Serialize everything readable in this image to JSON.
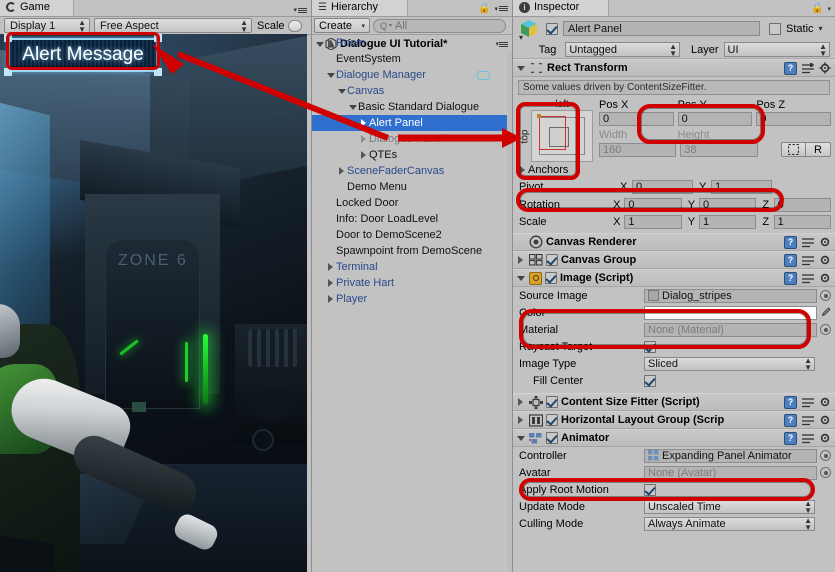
{
  "game": {
    "tab_label": "Game",
    "display_dropdown": "Display 1",
    "aspect_dropdown": "Free Aspect",
    "scale_label": "Scale",
    "alert_panel_text": "Alert Message",
    "scene_sign_text": "ZONE 6"
  },
  "hierarchy": {
    "tab_label": "Hierarchy",
    "create_button": "Create",
    "search_placeholder": "All",
    "scene_name": "Dialogue UI Tutorial*",
    "items": [
      {
        "label": "Room",
        "depth": 1,
        "arrow": "right",
        "style": "prefab"
      },
      {
        "label": "EventSystem",
        "depth": 1,
        "arrow": "none",
        "style": "normal"
      },
      {
        "label": "Dialogue Manager",
        "depth": 1,
        "arrow": "down",
        "style": "prefab",
        "badge": "comment-icon"
      },
      {
        "label": "Canvas",
        "depth": 2,
        "arrow": "down",
        "style": "prefab"
      },
      {
        "label": "Basic Standard Dialogue",
        "depth": 3,
        "arrow": "down",
        "style": "normal"
      },
      {
        "label": "Alert Panel",
        "depth": 4,
        "arrow": "right",
        "style": "normal",
        "selected": true
      },
      {
        "label": "Dialogue Panel",
        "depth": 4,
        "arrow": "right",
        "style": "dim"
      },
      {
        "label": "QTEs",
        "depth": 4,
        "arrow": "right",
        "style": "normal"
      },
      {
        "label": "SceneFaderCanvas",
        "depth": 2,
        "arrow": "right",
        "style": "prefab"
      },
      {
        "label": "Demo Menu",
        "depth": 2,
        "arrow": "none",
        "style": "normal"
      },
      {
        "label": "Locked Door",
        "depth": 1,
        "arrow": "none",
        "style": "normal"
      },
      {
        "label": "Info: Door LoadLevel",
        "depth": 1,
        "arrow": "none",
        "style": "normal"
      },
      {
        "label": "Door to DemoScene2",
        "depth": 1,
        "arrow": "none",
        "style": "normal"
      },
      {
        "label": "Spawnpoint from DemoScene",
        "depth": 1,
        "arrow": "none",
        "style": "normal"
      },
      {
        "label": "Terminal",
        "depth": 1,
        "arrow": "right",
        "style": "prefab"
      },
      {
        "label": "Private Hart",
        "depth": 1,
        "arrow": "right",
        "style": "prefab"
      },
      {
        "label": "Player",
        "depth": 1,
        "arrow": "right",
        "style": "prefab"
      }
    ]
  },
  "inspector": {
    "tab_label": "Inspector",
    "object_name": "Alert Panel",
    "object_enabled": true,
    "static_label": "Static",
    "static_checked": false,
    "tag_label": "Tag",
    "tag_value": "Untagged",
    "layer_label": "Layer",
    "layer_value": "UI",
    "rect_transform": {
      "title": "Rect Transform",
      "driven_note": "Some values driven by ContentSizeFitter.",
      "anchor_preset_label": "left",
      "anchor_preset_vlabel": "top",
      "pos_x_label": "Pos X",
      "pos_x_value": "0",
      "pos_y_label": "Pos Y",
      "pos_y_value": "0",
      "pos_z_label": "Pos Z",
      "pos_z_value": "0",
      "width_label": "Width",
      "width_value": "160",
      "height_label": "Height",
      "height_value": "38",
      "blueprint_button": "blueprint-icon",
      "raw_button": "R",
      "anchors_label": "Anchors",
      "pivot_label": "Pivot",
      "pivot_x_axis": "X",
      "pivot_x_value": "0",
      "pivot_y_axis": "Y",
      "pivot_y_value": "1",
      "rotation_label": "Rotation",
      "rotation_x": "0",
      "rotation_y": "0",
      "rotation_z": "0",
      "scale_label": "Scale",
      "scale_x": "1",
      "scale_y": "1",
      "scale_z": "1",
      "axis_x": "X",
      "axis_y": "Y",
      "axis_z": "Z"
    },
    "canvas_renderer": {
      "title": "Canvas Renderer"
    },
    "canvas_group": {
      "title": "Canvas Group",
      "enabled": true
    },
    "image_script": {
      "title": "Image (Script)",
      "enabled": true,
      "source_image_label": "Source Image",
      "source_image_value": "Dialog_stripes",
      "color_label": "Color",
      "color_value": "#FFFFFF",
      "material_label": "Material",
      "material_value": "None (Material)",
      "raycast_label": "Raycast Target",
      "raycast_checked": true,
      "image_type_label": "Image Type",
      "image_type_value": "Sliced",
      "fill_center_label": "Fill Center",
      "fill_center_checked": true
    },
    "content_size_fitter": {
      "title": "Content Size Fitter (Script)",
      "enabled": true
    },
    "horizontal_layout_group": {
      "title": "Horizontal Layout Group (Scrip",
      "enabled": true
    },
    "animator": {
      "title": "Animator",
      "enabled": true,
      "controller_label": "Controller",
      "controller_value": "Expanding Panel Animator",
      "avatar_label": "Avatar",
      "avatar_value": "None (Avatar)",
      "apply_root_motion_label": "Apply Root Motion",
      "apply_root_motion_checked": true,
      "update_mode_label": "Update Mode",
      "update_mode_value": "Unscaled Time",
      "culling_mode_label": "Culling Mode",
      "culling_mode_value": "Always Animate"
    }
  },
  "colors": {
    "annotation_red": "#d10000",
    "selection_blue": "#2f6fd0",
    "panel_gray": "#c2c2c2"
  }
}
